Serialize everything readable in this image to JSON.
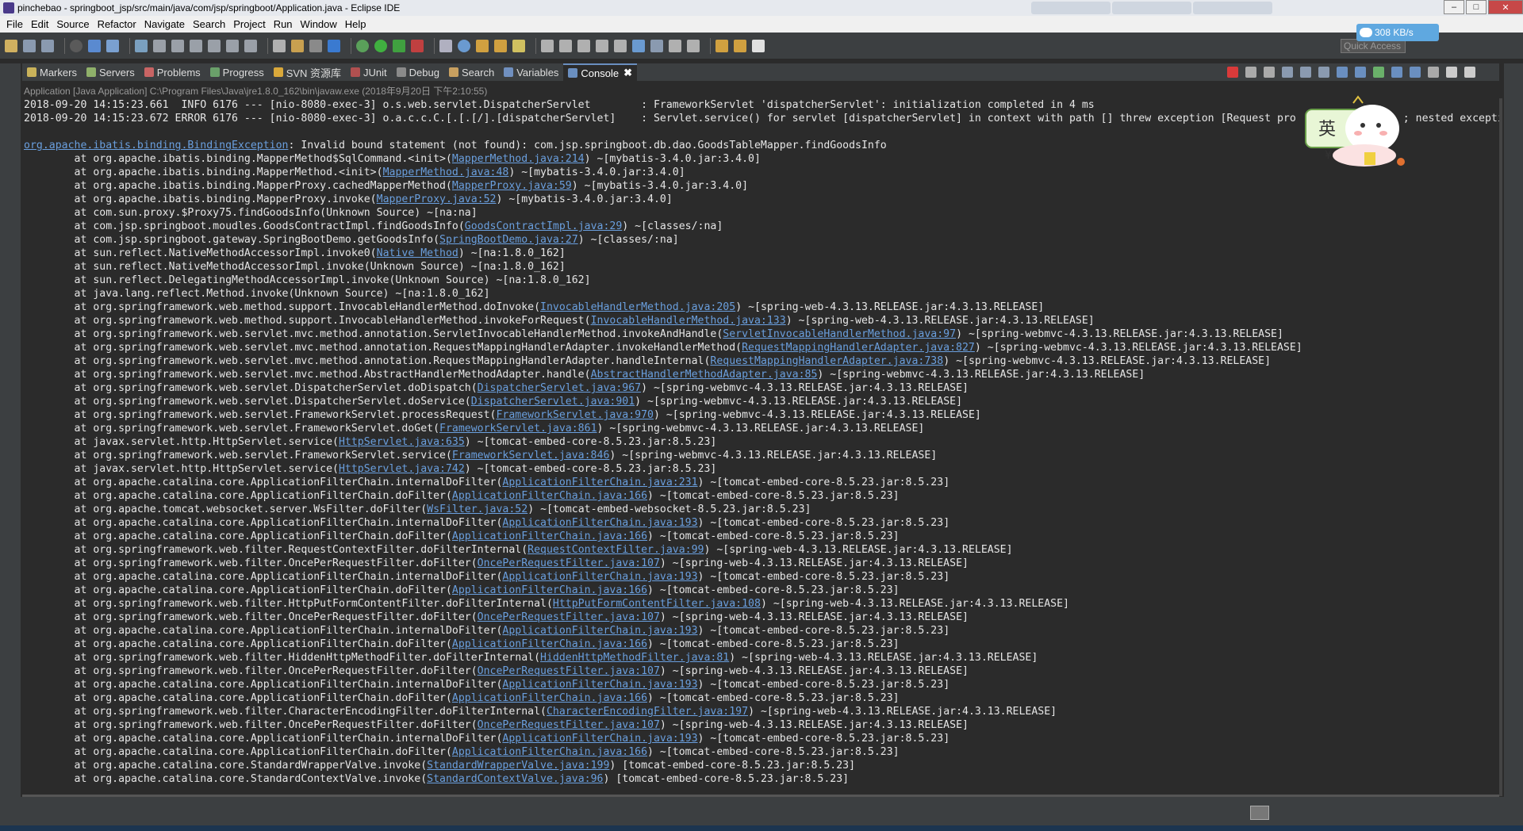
{
  "window": {
    "title": "pinchebao - springboot_jsp/src/main/java/com/jsp/springboot/Application.java - Eclipse IDE"
  },
  "menu": [
    "File",
    "Edit",
    "Source",
    "Refactor",
    "Navigate",
    "Search",
    "Project",
    "Run",
    "Window",
    "Help"
  ],
  "toolbar": {
    "quick_access": "Quick Access",
    "net_speed": "308 KB/s"
  },
  "views": {
    "tabs": [
      {
        "label": "Markers",
        "icon": "markers-icon",
        "color": "#c9b25a"
      },
      {
        "label": "Servers",
        "icon": "servers-icon",
        "color": "#8fb06a"
      },
      {
        "label": "Problems",
        "icon": "problems-icon",
        "color": "#c86464"
      },
      {
        "label": "Progress",
        "icon": "progress-icon",
        "color": "#6aa06a"
      },
      {
        "label": "SVN 资源库",
        "icon": "svn-icon",
        "color": "#d9a83a"
      },
      {
        "label": "JUnit",
        "icon": "junit-icon",
        "color": "#b05050"
      },
      {
        "label": "Debug",
        "icon": "debug-icon",
        "color": "#8a8a8a"
      },
      {
        "label": "Search",
        "icon": "search-icon",
        "color": "#c8a060"
      },
      {
        "label": "Variables",
        "icon": "variables-icon",
        "color": "#7090c0"
      },
      {
        "label": "Console",
        "icon": "console-icon",
        "color": "#6a8fc0"
      }
    ],
    "active": "Console"
  },
  "console": {
    "process": "Application [Java Application] C:\\Program Files\\Java\\jre1.8.0_162\\bin\\javaw.exe (2018年9月20日 下午2:10:55)",
    "lines": [
      [
        {
          "t": "2018-09-20 14:15:23.661  INFO 6176 --- [nio-8080-exec-3] o.s.web.servlet.DispatcherServlet        : FrameworkServlet 'dispatcherServlet': initialization completed in 4 ms"
        }
      ],
      [
        {
          "t": "2018-09-20 14:15:23.672 ERROR 6176 --- [nio-8080-exec-3] o.a.c.c.C.[.[.[/].[dispatcherServlet]    : Servlet.service() for servlet [dispatcherServlet] in context with path [] threw exception [Request pro"
        },
        {
          "t": "                 ; nested excepti"
        }
      ],
      [
        {
          "t": ""
        }
      ],
      [
        {
          "t": "org.apache.ibatis.binding.BindingException",
          "link": true
        },
        {
          "t": ": Invalid bound statement (not found): com.jsp.springboot.db.dao.GoodsTableMapper.findGoodsInfo"
        }
      ],
      [
        {
          "t": "\tat org.apache.ibatis.binding.MapperMethod$SqlCommand.<init>("
        },
        {
          "t": "MapperMethod.java:214",
          "link": true
        },
        {
          "t": ") ~[mybatis-3.4.0.jar:3.4.0]"
        }
      ],
      [
        {
          "t": "\tat org.apache.ibatis.binding.MapperMethod.<init>("
        },
        {
          "t": "MapperMethod.java:48",
          "link": true
        },
        {
          "t": ") ~[mybatis-3.4.0.jar:3.4.0]"
        }
      ],
      [
        {
          "t": "\tat org.apache.ibatis.binding.MapperProxy.cachedMapperMethod("
        },
        {
          "t": "MapperProxy.java:59",
          "link": true
        },
        {
          "t": ") ~[mybatis-3.4.0.jar:3.4.0]"
        }
      ],
      [
        {
          "t": "\tat org.apache.ibatis.binding.MapperProxy.invoke("
        },
        {
          "t": "MapperProxy.java:52",
          "link": true
        },
        {
          "t": ") ~[mybatis-3.4.0.jar:3.4.0]"
        }
      ],
      [
        {
          "t": "\tat com.sun.proxy.$Proxy75.findGoodsInfo(Unknown Source) ~[na:na]"
        }
      ],
      [
        {
          "t": "\tat com.jsp.springboot.moudles.GoodsContractImpl.findGoodsInfo("
        },
        {
          "t": "GoodsContractImpl.java:29",
          "link": true
        },
        {
          "t": ") ~[classes/:na]"
        }
      ],
      [
        {
          "t": "\tat com.jsp.springboot.gateway.SpringBootDemo.getGoodsInfo("
        },
        {
          "t": "SpringBootDemo.java:27",
          "link": true
        },
        {
          "t": ") ~[classes/:na]"
        }
      ],
      [
        {
          "t": "\tat sun.reflect.NativeMethodAccessorImpl.invoke0("
        },
        {
          "t": "Native Method",
          "link": true
        },
        {
          "t": ") ~[na:1.8.0_162]"
        }
      ],
      [
        {
          "t": "\tat sun.reflect.NativeMethodAccessorImpl.invoke(Unknown Source) ~[na:1.8.0_162]"
        }
      ],
      [
        {
          "t": "\tat sun.reflect.DelegatingMethodAccessorImpl.invoke(Unknown Source) ~[na:1.8.0_162]"
        }
      ],
      [
        {
          "t": "\tat java.lang.reflect.Method.invoke(Unknown Source) ~[na:1.8.0_162]"
        }
      ],
      [
        {
          "t": "\tat org.springframework.web.method.support.InvocableHandlerMethod.doInvoke("
        },
        {
          "t": "InvocableHandlerMethod.java:205",
          "link": true
        },
        {
          "t": ") ~[spring-web-4.3.13.RELEASE.jar:4.3.13.RELEASE]"
        }
      ],
      [
        {
          "t": "\tat org.springframework.web.method.support.InvocableHandlerMethod.invokeForRequest("
        },
        {
          "t": "InvocableHandlerMethod.java:133",
          "link": true
        },
        {
          "t": ") ~[spring-web-4.3.13.RELEASE.jar:4.3.13.RELEASE]"
        }
      ],
      [
        {
          "t": "\tat org.springframework.web.servlet.mvc.method.annotation.ServletInvocableHandlerMethod.invokeAndHandle("
        },
        {
          "t": "ServletInvocableHandlerMethod.java:97",
          "link": true
        },
        {
          "t": ") ~[spring-webmvc-4.3.13.RELEASE.jar:4.3.13.RELEASE]"
        }
      ],
      [
        {
          "t": "\tat org.springframework.web.servlet.mvc.method.annotation.RequestMappingHandlerAdapter.invokeHandlerMethod("
        },
        {
          "t": "RequestMappingHandlerAdapter.java:827",
          "link": true
        },
        {
          "t": ") ~[spring-webmvc-4.3.13.RELEASE.jar:4.3.13.RELEASE]"
        }
      ],
      [
        {
          "t": "\tat org.springframework.web.servlet.mvc.method.annotation.RequestMappingHandlerAdapter.handleInternal("
        },
        {
          "t": "RequestMappingHandlerAdapter.java:738",
          "link": true
        },
        {
          "t": ") ~[spring-webmvc-4.3.13.RELEASE.jar:4.3.13.RELEASE]"
        }
      ],
      [
        {
          "t": "\tat org.springframework.web.servlet.mvc.method.AbstractHandlerMethodAdapter.handle("
        },
        {
          "t": "AbstractHandlerMethodAdapter.java:85",
          "link": true
        },
        {
          "t": ") ~[spring-webmvc-4.3.13.RELEASE.jar:4.3.13.RELEASE]"
        }
      ],
      [
        {
          "t": "\tat org.springframework.web.servlet.DispatcherServlet.doDispatch("
        },
        {
          "t": "DispatcherServlet.java:967",
          "link": true
        },
        {
          "t": ") ~[spring-webmvc-4.3.13.RELEASE.jar:4.3.13.RELEASE]"
        }
      ],
      [
        {
          "t": "\tat org.springframework.web.servlet.DispatcherServlet.doService("
        },
        {
          "t": "DispatcherServlet.java:901",
          "link": true
        },
        {
          "t": ") ~[spring-webmvc-4.3.13.RELEASE.jar:4.3.13.RELEASE]"
        }
      ],
      [
        {
          "t": "\tat org.springframework.web.servlet.FrameworkServlet.processRequest("
        },
        {
          "t": "FrameworkServlet.java:970",
          "link": true
        },
        {
          "t": ") ~[spring-webmvc-4.3.13.RELEASE.jar:4.3.13.RELEASE]"
        }
      ],
      [
        {
          "t": "\tat org.springframework.web.servlet.FrameworkServlet.doGet("
        },
        {
          "t": "FrameworkServlet.java:861",
          "link": true
        },
        {
          "t": ") ~[spring-webmvc-4.3.13.RELEASE.jar:4.3.13.RELEASE]"
        }
      ],
      [
        {
          "t": "\tat javax.servlet.http.HttpServlet.service("
        },
        {
          "t": "HttpServlet.java:635",
          "link": true
        },
        {
          "t": ") ~[tomcat-embed-core-8.5.23.jar:8.5.23]"
        }
      ],
      [
        {
          "t": "\tat org.springframework.web.servlet.FrameworkServlet.service("
        },
        {
          "t": "FrameworkServlet.java:846",
          "link": true
        },
        {
          "t": ") ~[spring-webmvc-4.3.13.RELEASE.jar:4.3.13.RELEASE]"
        }
      ],
      [
        {
          "t": "\tat javax.servlet.http.HttpServlet.service("
        },
        {
          "t": "HttpServlet.java:742",
          "link": true
        },
        {
          "t": ") ~[tomcat-embed-core-8.5.23.jar:8.5.23]"
        }
      ],
      [
        {
          "t": "\tat org.apache.catalina.core.ApplicationFilterChain.internalDoFilter("
        },
        {
          "t": "ApplicationFilterChain.java:231",
          "link": true
        },
        {
          "t": ") ~[tomcat-embed-core-8.5.23.jar:8.5.23]"
        }
      ],
      [
        {
          "t": "\tat org.apache.catalina.core.ApplicationFilterChain.doFilter("
        },
        {
          "t": "ApplicationFilterChain.java:166",
          "link": true
        },
        {
          "t": ") ~[tomcat-embed-core-8.5.23.jar:8.5.23]"
        }
      ],
      [
        {
          "t": "\tat org.apache.tomcat.websocket.server.WsFilter.doFilter("
        },
        {
          "t": "WsFilter.java:52",
          "link": true
        },
        {
          "t": ") ~[tomcat-embed-websocket-8.5.23.jar:8.5.23]"
        }
      ],
      [
        {
          "t": "\tat org.apache.catalina.core.ApplicationFilterChain.internalDoFilter("
        },
        {
          "t": "ApplicationFilterChain.java:193",
          "link": true
        },
        {
          "t": ") ~[tomcat-embed-core-8.5.23.jar:8.5.23]"
        }
      ],
      [
        {
          "t": "\tat org.apache.catalina.core.ApplicationFilterChain.doFilter("
        },
        {
          "t": "ApplicationFilterChain.java:166",
          "link": true
        },
        {
          "t": ") ~[tomcat-embed-core-8.5.23.jar:8.5.23]"
        }
      ],
      [
        {
          "t": "\tat org.springframework.web.filter.RequestContextFilter.doFilterInternal("
        },
        {
          "t": "RequestContextFilter.java:99",
          "link": true
        },
        {
          "t": ") ~[spring-web-4.3.13.RELEASE.jar:4.3.13.RELEASE]"
        }
      ],
      [
        {
          "t": "\tat org.springframework.web.filter.OncePerRequestFilter.doFilter("
        },
        {
          "t": "OncePerRequestFilter.java:107",
          "link": true
        },
        {
          "t": ") ~[spring-web-4.3.13.RELEASE.jar:4.3.13.RELEASE]"
        }
      ],
      [
        {
          "t": "\tat org.apache.catalina.core.ApplicationFilterChain.internalDoFilter("
        },
        {
          "t": "ApplicationFilterChain.java:193",
          "link": true
        },
        {
          "t": ") ~[tomcat-embed-core-8.5.23.jar:8.5.23]"
        }
      ],
      [
        {
          "t": "\tat org.apache.catalina.core.ApplicationFilterChain.doFilter("
        },
        {
          "t": "ApplicationFilterChain.java:166",
          "link": true
        },
        {
          "t": ") ~[tomcat-embed-core-8.5.23.jar:8.5.23]"
        }
      ],
      [
        {
          "t": "\tat org.springframework.web.filter.HttpPutFormContentFilter.doFilterInternal("
        },
        {
          "t": "HttpPutFormContentFilter.java:108",
          "link": true
        },
        {
          "t": ") ~[spring-web-4.3.13.RELEASE.jar:4.3.13.RELEASE]"
        }
      ],
      [
        {
          "t": "\tat org.springframework.web.filter.OncePerRequestFilter.doFilter("
        },
        {
          "t": "OncePerRequestFilter.java:107",
          "link": true
        },
        {
          "t": ") ~[spring-web-4.3.13.RELEASE.jar:4.3.13.RELEASE]"
        }
      ],
      [
        {
          "t": "\tat org.apache.catalina.core.ApplicationFilterChain.internalDoFilter("
        },
        {
          "t": "ApplicationFilterChain.java:193",
          "link": true
        },
        {
          "t": ") ~[tomcat-embed-core-8.5.23.jar:8.5.23]"
        }
      ],
      [
        {
          "t": "\tat org.apache.catalina.core.ApplicationFilterChain.doFilter("
        },
        {
          "t": "ApplicationFilterChain.java:166",
          "link": true
        },
        {
          "t": ") ~[tomcat-embed-core-8.5.23.jar:8.5.23]"
        }
      ],
      [
        {
          "t": "\tat org.springframework.web.filter.HiddenHttpMethodFilter.doFilterInternal("
        },
        {
          "t": "HiddenHttpMethodFilter.java:81",
          "link": true
        },
        {
          "t": ") ~[spring-web-4.3.13.RELEASE.jar:4.3.13.RELEASE]"
        }
      ],
      [
        {
          "t": "\tat org.springframework.web.filter.OncePerRequestFilter.doFilter("
        },
        {
          "t": "OncePerRequestFilter.java:107",
          "link": true
        },
        {
          "t": ") ~[spring-web-4.3.13.RELEASE.jar:4.3.13.RELEASE]"
        }
      ],
      [
        {
          "t": "\tat org.apache.catalina.core.ApplicationFilterChain.internalDoFilter("
        },
        {
          "t": "ApplicationFilterChain.java:193",
          "link": true
        },
        {
          "t": ") ~[tomcat-embed-core-8.5.23.jar:8.5.23]"
        }
      ],
      [
        {
          "t": "\tat org.apache.catalina.core.ApplicationFilterChain.doFilter("
        },
        {
          "t": "ApplicationFilterChain.java:166",
          "link": true
        },
        {
          "t": ") ~[tomcat-embed-core-8.5.23.jar:8.5.23]"
        }
      ],
      [
        {
          "t": "\tat org.springframework.web.filter.CharacterEncodingFilter.doFilterInternal("
        },
        {
          "t": "CharacterEncodingFilter.java:197",
          "link": true
        },
        {
          "t": ") ~[spring-web-4.3.13.RELEASE.jar:4.3.13.RELEASE]"
        }
      ],
      [
        {
          "t": "\tat org.springframework.web.filter.OncePerRequestFilter.doFilter("
        },
        {
          "t": "OncePerRequestFilter.java:107",
          "link": true
        },
        {
          "t": ") ~[spring-web-4.3.13.RELEASE.jar:4.3.13.RELEASE]"
        }
      ],
      [
        {
          "t": "\tat org.apache.catalina.core.ApplicationFilterChain.internalDoFilter("
        },
        {
          "t": "ApplicationFilterChain.java:193",
          "link": true
        },
        {
          "t": ") ~[tomcat-embed-core-8.5.23.jar:8.5.23]"
        }
      ],
      [
        {
          "t": "\tat org.apache.catalina.core.ApplicationFilterChain.doFilter("
        },
        {
          "t": "ApplicationFilterChain.java:166",
          "link": true
        },
        {
          "t": ") ~[tomcat-embed-core-8.5.23.jar:8.5.23]"
        }
      ],
      [
        {
          "t": "\tat org.apache.catalina.core.StandardWrapperValve.invoke("
        },
        {
          "t": "StandardWrapperValve.java:199",
          "link": true
        },
        {
          "t": ") [tomcat-embed-core-8.5.23.jar:8.5.23]"
        }
      ],
      [
        {
          "t": "\tat org.apache.catalina.core.StandardContextValve.invoke("
        },
        {
          "t": "StandardContextValve.java:96",
          "link": true
        },
        {
          "t": ") [tomcat-embed-core-8.5.23.jar:8.5.23]"
        }
      ]
    ]
  },
  "colors": {
    "console_bg": "#2b2b2b",
    "link": "#6a9fde",
    "text": "#e6e6e6",
    "error_stop": "#d93a3a"
  }
}
